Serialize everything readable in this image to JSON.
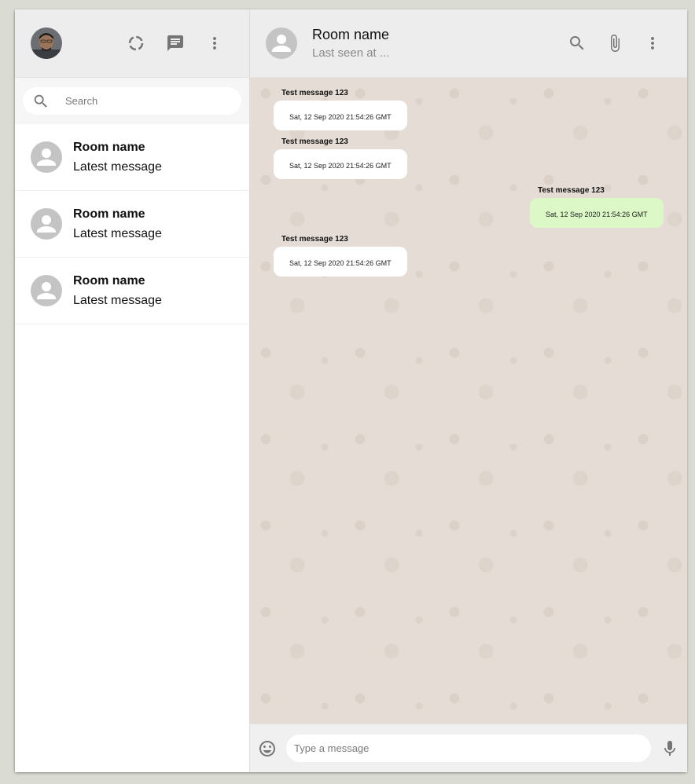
{
  "sidebar": {
    "search": {
      "placeholder": "Search",
      "value": ""
    },
    "rooms": [
      {
        "name": "Room name",
        "last_message": "Latest message"
      },
      {
        "name": "Room name",
        "last_message": "Latest message"
      },
      {
        "name": "Room name",
        "last_message": "Latest message"
      }
    ]
  },
  "chat": {
    "header": {
      "room_name": "Room name",
      "last_seen": "Last seen at ..."
    },
    "messages": [
      {
        "sender": "Test message 123",
        "timestamp": "Sat, 12 Sep 2020 21:54:26 GMT",
        "side": "left"
      },
      {
        "sender": "Test message 123",
        "timestamp": "Sat, 12 Sep 2020 21:54:26 GMT",
        "side": "left"
      },
      {
        "sender": "Test message 123",
        "timestamp": "Sat, 12 Sep 2020 21:54:26 GMT",
        "side": "right"
      },
      {
        "sender": "Test message 123",
        "timestamp": "Sat, 12 Sep 2020 21:54:26 GMT",
        "side": "left"
      }
    ],
    "footer": {
      "placeholder": "Type a message",
      "value": ""
    }
  },
  "colors": {
    "background": "#dadbd3",
    "header": "#ededed",
    "chat_wallpaper": "#e5ddd5",
    "sent_bubble": "#dcf8c6",
    "received_bubble": "#ffffff",
    "icon": "#757575"
  },
  "icons": {
    "status": "status-icon",
    "new_chat": "chat-icon",
    "menu": "more-vert-icon",
    "search": "search-icon",
    "attach": "attach-file-icon",
    "emoji": "emoji-icon",
    "mic": "mic-icon"
  }
}
